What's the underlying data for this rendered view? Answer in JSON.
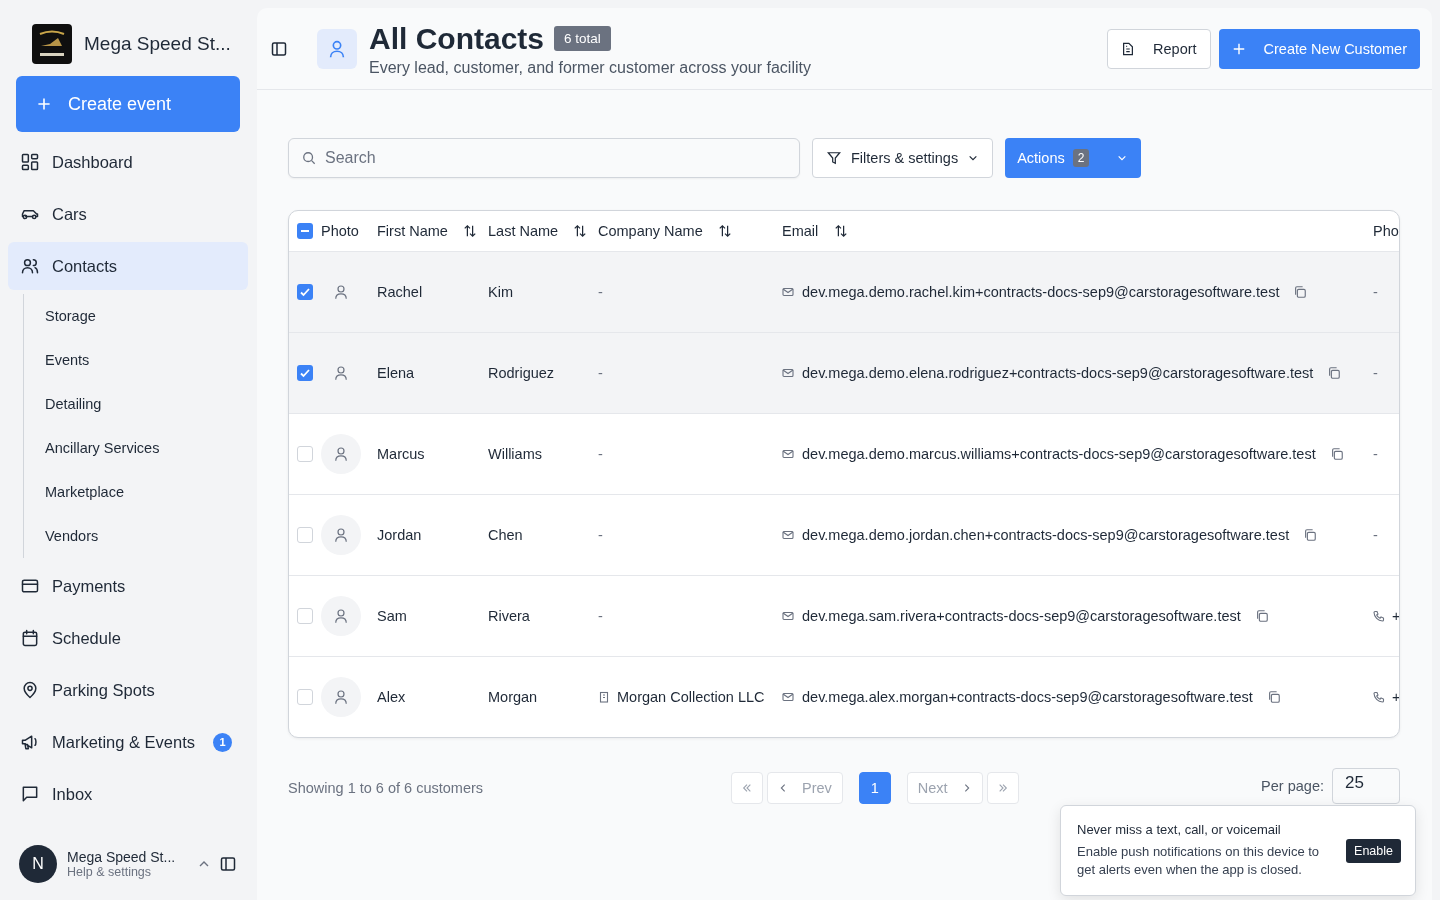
{
  "sidebar": {
    "brand": "Mega Speed St...",
    "create_button": "Create event",
    "items": [
      {
        "label": "Dashboard",
        "selected": false
      },
      {
        "label": "Cars",
        "selected": false
      },
      {
        "label": "Contacts",
        "selected": true,
        "children": [
          {
            "label": "Storage",
            "selected": false
          },
          {
            "label": "Events",
            "selected": false
          },
          {
            "label": "Detailing",
            "selected": false
          },
          {
            "label": "Ancillary Services",
            "selected": false
          },
          {
            "label": "Marketplace",
            "selected": false
          },
          {
            "label": "Vendors",
            "selected": false
          }
        ]
      },
      {
        "label": "Payments",
        "selected": false
      },
      {
        "label": "Schedule",
        "selected": false
      },
      {
        "label": "Parking Spots",
        "selected": false
      },
      {
        "label": "Marketing & Events",
        "selected": false,
        "badge": "1"
      },
      {
        "label": "Inbox",
        "selected": false
      }
    ],
    "account": {
      "avatar": "N",
      "name": "Mega Speed St...",
      "subtitle": "Help & settings"
    }
  },
  "header": {
    "title": "All Contacts",
    "count_badge": "6 total",
    "subtitle": "Every lead, customer, and former customer across your facility",
    "buttons": [
      {
        "label": "Report",
        "kind": "secondary"
      },
      {
        "label": "Create New Customer",
        "kind": "primary"
      }
    ]
  },
  "toolbar": {
    "search": {
      "placeholder": "Search"
    },
    "filters_button": "Filters & settings",
    "actions_button": {
      "label": "Actions",
      "count": "2"
    }
  },
  "table": {
    "select_all_partial": true,
    "columns": [
      "Photo",
      "First Name",
      "Last Name",
      "Company Name",
      "Email",
      "Pho"
    ],
    "rows": [
      {
        "selected": true,
        "first": "Rachel",
        "last": "Kim",
        "company": {
          "kind": "none",
          "text": "-"
        },
        "email": "dev.mega.demo.rachel.kim+contracts-docs-sep9@carstoragesoftware.test",
        "phone": {
          "kind": "none",
          "text": "-"
        }
      },
      {
        "selected": true,
        "first": "Elena",
        "last": "Rodriguez",
        "company": {
          "kind": "none",
          "text": "-"
        },
        "email": "dev.mega.demo.elena.rodriguez+contracts-docs-sep9@carstoragesoftware.test",
        "phone": {
          "kind": "none",
          "text": "-"
        }
      },
      {
        "selected": false,
        "first": "Marcus",
        "last": "Williams",
        "company": {
          "kind": "none",
          "text": "-"
        },
        "email": "dev.mega.demo.marcus.williams+contracts-docs-sep9@carstoragesoftware.test",
        "phone": {
          "kind": "none",
          "text": "-"
        }
      },
      {
        "selected": false,
        "first": "Jordan",
        "last": "Chen",
        "company": {
          "kind": "none",
          "text": "-"
        },
        "email": "dev.mega.demo.jordan.chen+contracts-docs-sep9@carstoragesoftware.test",
        "phone": {
          "kind": "none",
          "text": "-"
        }
      },
      {
        "selected": false,
        "first": "Sam",
        "last": "Rivera",
        "company": {
          "kind": "none",
          "text": "-"
        },
        "email": "dev.mega.sam.rivera+contracts-docs-sep9@carstoragesoftware.test",
        "phone": {
          "kind": "number",
          "text": "+"
        }
      },
      {
        "selected": false,
        "first": "Alex",
        "last": "Morgan",
        "company": {
          "kind": "company",
          "text": "Morgan Collection LLC"
        },
        "email": "dev.mega.alex.morgan+contracts-docs-sep9@carstoragesoftware.test",
        "phone": {
          "kind": "number",
          "text": "+"
        }
      }
    ]
  },
  "pagination": {
    "summary": "Showing 1 to 6 of 6 customers",
    "first_disabled": true,
    "prev": {
      "label": "Prev",
      "disabled": true
    },
    "pages": [
      {
        "label": "1",
        "selected": true
      }
    ],
    "next": {
      "label": "Next",
      "disabled": true
    },
    "last_disabled": true,
    "per_page_label": "Per page:",
    "per_page": "25"
  },
  "toast": {
    "title": "Never miss a text, call, or voicemail",
    "body": "Enable push notifications on this device to get alerts even when the app is closed.",
    "button": "Enable"
  }
}
